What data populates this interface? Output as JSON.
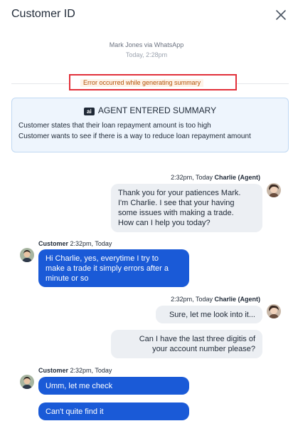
{
  "header": {
    "title": "Customer ID",
    "close_icon": "close-icon"
  },
  "conversation": {
    "source": "Mark Jones via WhatsApp",
    "time": "Today, 2:28pm"
  },
  "error": {
    "text": "Error occurred while generating summary",
    "border_color": "#e2303a"
  },
  "summary": {
    "badge": "ai",
    "heading": "AGENT ENTERED SUMMARY",
    "lines": [
      "Customer states that their loan repayment amount is  too high",
      "Customer wants to see if there is a way to reduce loan repayment amount"
    ]
  },
  "messages": [
    {
      "sender": "Charlie (Agent)",
      "time": "2:32pm, Today",
      "lines": [
        "Thank you for your patiences Mark.",
        "I'm Charlie. I see that your having",
        "some issues with making a trade.",
        "How can I help you today?"
      ]
    },
    {
      "sender": "Customer",
      "time": "2:32pm, Today",
      "lines": [
        "Hi Charlie, yes, everytime I try to",
        "make a trade it simply errors after a",
        "minute or so"
      ]
    },
    {
      "sender": "Charlie (Agent)",
      "time": "2:32pm, Today",
      "lines": [
        "Sure, let me look into it..."
      ]
    },
    {
      "lines": [
        "Can I have the last three digitis of",
        "your account number please?"
      ]
    },
    {
      "sender": "Customer",
      "time": "2:32pm, Today",
      "lines": [
        "Umm, let me check"
      ]
    },
    {
      "lines": [
        "Can't quite find it"
      ]
    }
  ],
  "colors": {
    "customer_bubble": "#1a5ad7",
    "agent_bubble": "#eceff3",
    "summary_bg": "#eef5fd"
  }
}
